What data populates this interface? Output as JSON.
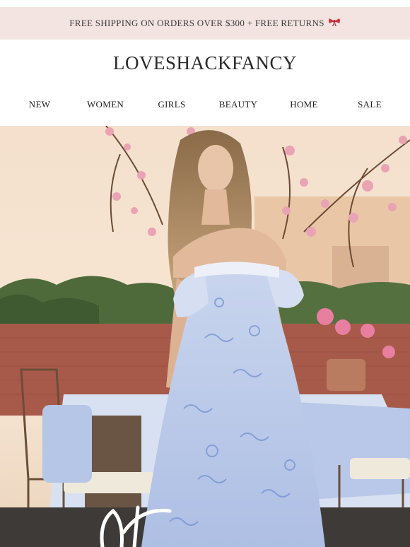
{
  "banner": {
    "text": "FREE SHIPPING ON ORDERS OVER $300 + FREE RETURNS",
    "icon": "bow-icon",
    "icon_color": "#d1323f",
    "background": "#f3e4e1"
  },
  "brand": {
    "logo": "LOVESHACKFANCY"
  },
  "nav": {
    "items": [
      "NEW",
      "WOMEN",
      "GIRLS",
      "BEAUTY",
      "HOME",
      "SALE"
    ]
  },
  "hero": {
    "image": "model-in-blue-floral-dress-on-terrace"
  }
}
